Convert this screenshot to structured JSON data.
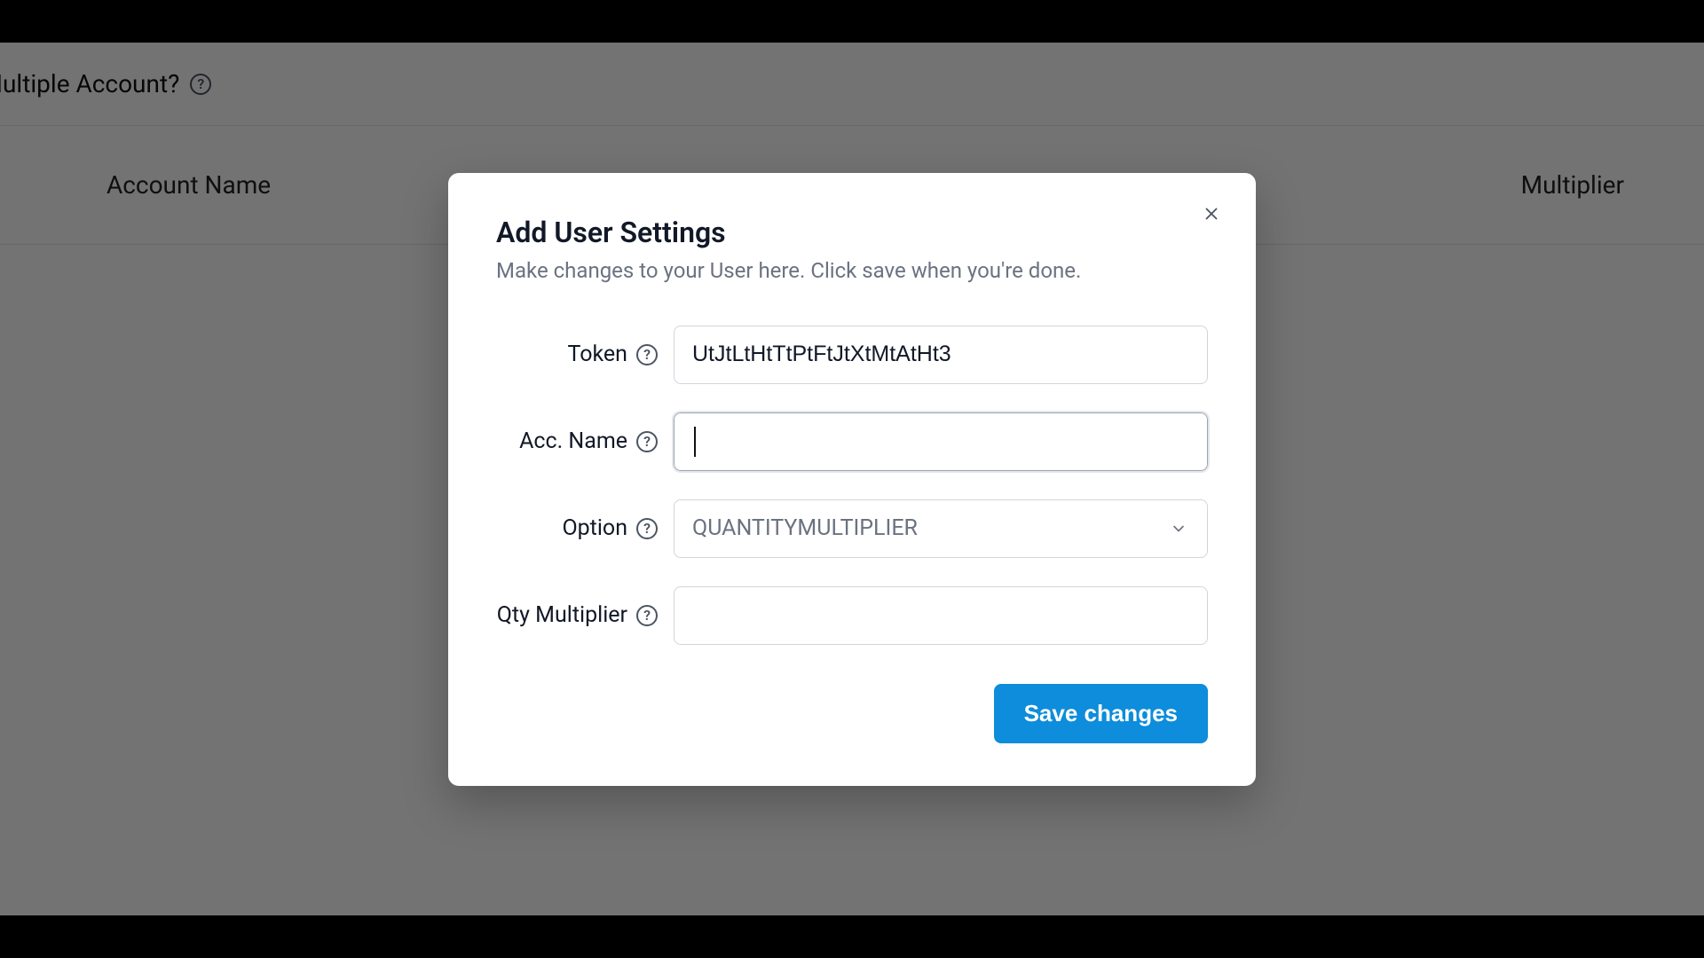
{
  "background": {
    "header_link": "dd Multiple Account?",
    "col_left": "Account Name",
    "col_right": "Multiplier"
  },
  "modal": {
    "title": "Add User Settings",
    "subtitle": "Make changes to your User here. Click save when you're done.",
    "labels": {
      "token": "Token",
      "acc_name": "Acc. Name",
      "option": "Option",
      "qty_multiplier": "Qty Multiplier"
    },
    "fields": {
      "token_value": "UtJtLtHtTtPtFtJtXtMtAtHt3",
      "acc_name_value": "",
      "option_value": "QUANTITYMULTIPLIER",
      "qty_multiplier_value": ""
    },
    "save_label": "Save changes"
  }
}
